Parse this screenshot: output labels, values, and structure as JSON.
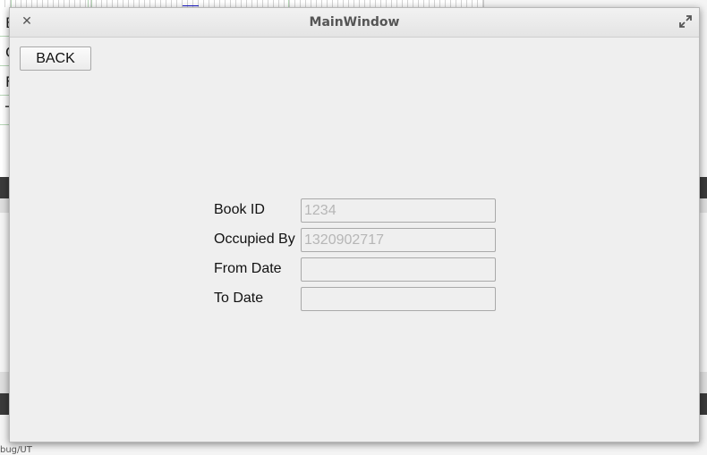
{
  "window": {
    "title": "MainWindow",
    "close_icon": "close-icon",
    "maximize_icon": "maximize-icon"
  },
  "toolbar": {
    "back_label": "BACK"
  },
  "form": {
    "fields": [
      {
        "label": "Book ID",
        "value": "",
        "placeholder": "1234"
      },
      {
        "label": "Occupied By",
        "value": "",
        "placeholder": "1320902717"
      },
      {
        "label": "From Date",
        "value": "",
        "placeholder": ""
      },
      {
        "label": "To Date",
        "value": "",
        "placeholder": ""
      }
    ]
  },
  "background": {
    "row_letters": [
      "B",
      "C",
      "F",
      "T"
    ],
    "status_text": "bug/UT"
  },
  "colors": {
    "window_bg": "#efefef",
    "titlebar_text": "#555555",
    "placeholder_text": "#b6b6b6"
  }
}
